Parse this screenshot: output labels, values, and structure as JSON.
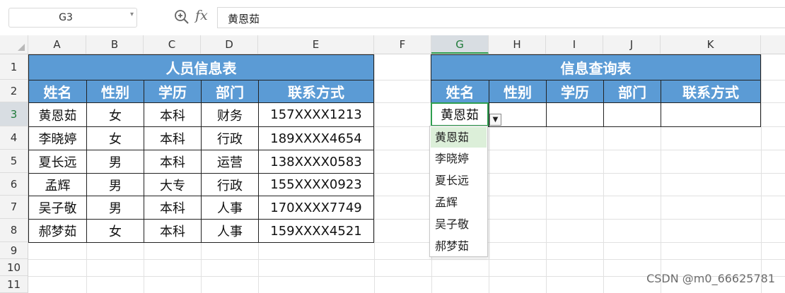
{
  "formula_bar": {
    "cell_ref": "G3",
    "fx_label": "fx",
    "formula_value": "黄恩茹"
  },
  "columns": [
    "A",
    "B",
    "C",
    "D",
    "E",
    "F",
    "G",
    "H",
    "I",
    "J",
    "K"
  ],
  "rows": [
    "1",
    "2",
    "3",
    "4",
    "5",
    "6",
    "7",
    "8",
    "9",
    "10",
    "11"
  ],
  "personnel_table": {
    "title": "人员信息表",
    "headers": [
      "姓名",
      "性别",
      "学历",
      "部门",
      "联系方式"
    ],
    "records": [
      [
        "黄恩茹",
        "女",
        "本科",
        "财务",
        "157XXXX1213"
      ],
      [
        "李晓婷",
        "女",
        "本科",
        "行政",
        "189XXXX4654"
      ],
      [
        "夏长远",
        "男",
        "本科",
        "运营",
        "138XXXX0583"
      ],
      [
        "孟辉",
        "男",
        "大专",
        "行政",
        "155XXXX0923"
      ],
      [
        "吴子敬",
        "男",
        "本科",
        "人事",
        "170XXXX7749"
      ],
      [
        "郝梦茹",
        "女",
        "本科",
        "人事",
        "159XXXX4521"
      ]
    ]
  },
  "query_table": {
    "title": "信息查询表",
    "headers": [
      "姓名",
      "性别",
      "学历",
      "部门",
      "联系方式"
    ],
    "selected_name": "黄恩茹"
  },
  "dropdown": {
    "options": [
      "黄恩茹",
      "李晓婷",
      "夏长远",
      "孟辉",
      "吴子敬",
      "郝梦茹"
    ],
    "highlighted_index": 0
  },
  "watermark": "CSDN @m0_66625781",
  "colors": {
    "table_header_fill": "#5b9bd5",
    "selection_green": "#2e9e4f",
    "dropdown_highlight": "#dcefd9"
  }
}
